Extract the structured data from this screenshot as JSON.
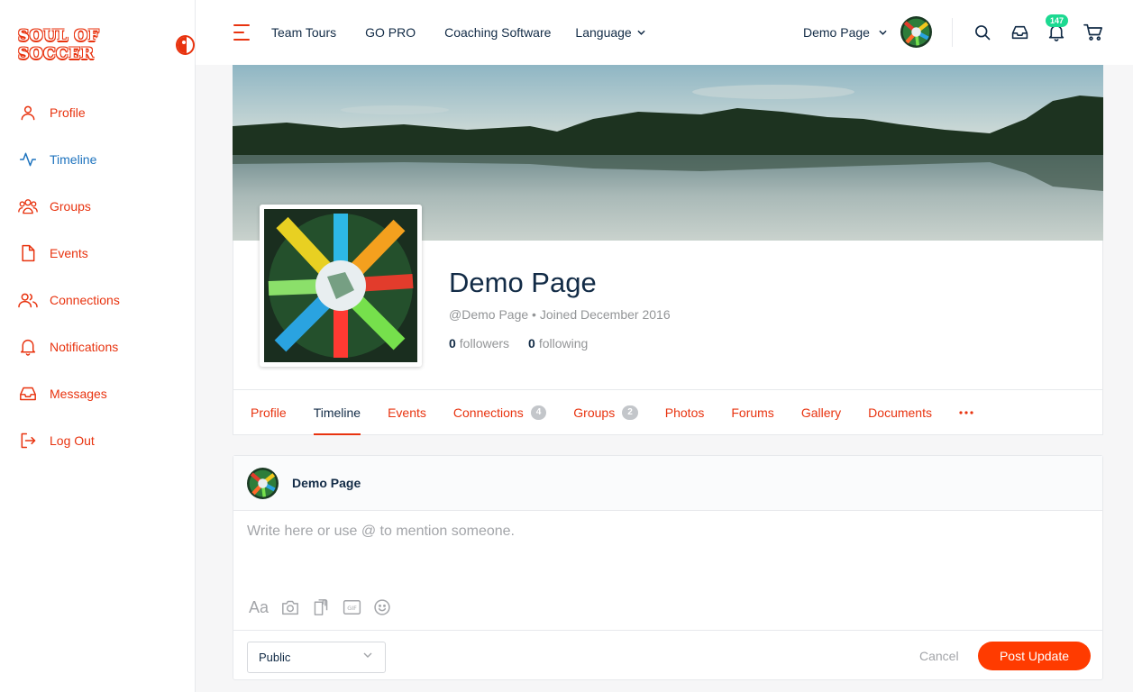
{
  "brand": {
    "logo_text": "SOUL OF SOCCER"
  },
  "sidebar": {
    "items": [
      {
        "label": "Profile",
        "icon": "user-icon"
      },
      {
        "label": "Timeline",
        "icon": "activity-icon"
      },
      {
        "label": "Groups",
        "icon": "groups-icon"
      },
      {
        "label": "Events",
        "icon": "file-icon"
      },
      {
        "label": "Connections",
        "icon": "users-icon"
      },
      {
        "label": "Notifications",
        "icon": "bell-icon"
      },
      {
        "label": "Messages",
        "icon": "inbox-icon"
      },
      {
        "label": "Log Out",
        "icon": "logout-icon"
      }
    ],
    "active": "Timeline"
  },
  "header": {
    "menu": [
      "Team Tours",
      "GO PRO",
      "Coaching Software",
      "Language"
    ],
    "user_name": "Demo Page",
    "notification_count": "147"
  },
  "profile": {
    "name": "Demo Page",
    "handle": "@Demo Page",
    "joined": "Joined December 2016",
    "followers_count": "0",
    "followers_label": "followers",
    "following_count": "0",
    "following_label": "following"
  },
  "tabs": [
    {
      "label": "Profile",
      "count": null
    },
    {
      "label": "Timeline",
      "count": null
    },
    {
      "label": "Events",
      "count": null
    },
    {
      "label": "Connections",
      "count": "4"
    },
    {
      "label": "Groups",
      "count": "2"
    },
    {
      "label": "Photos",
      "count": null
    },
    {
      "label": "Forums",
      "count": null
    },
    {
      "label": "Gallery",
      "count": null
    },
    {
      "label": "Documents",
      "count": null
    }
  ],
  "active_tab": "Timeline",
  "post_box": {
    "author": "Demo Page",
    "placeholder": "Write here or use @ to mention someone.",
    "format_label": "Aa",
    "privacy": "Public",
    "cancel_label": "Cancel",
    "submit_label": "Post Update"
  },
  "colors": {
    "accent": "#e8330f",
    "active_link": "#1e73be",
    "button": "#ff3b00",
    "badge": "#1cd991"
  }
}
